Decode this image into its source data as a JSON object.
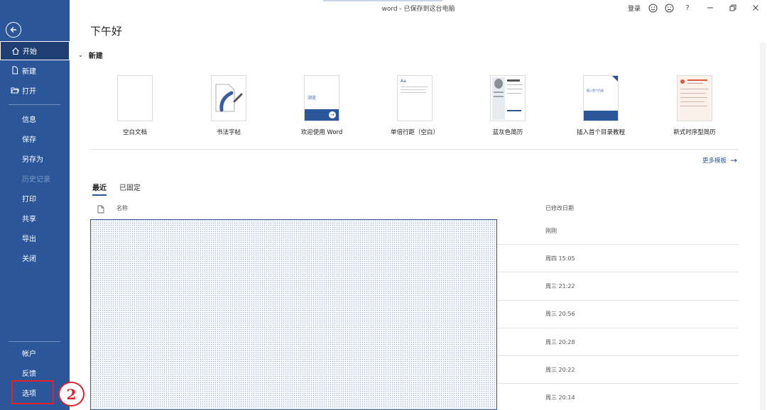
{
  "window": {
    "title": "word  -  已保存到这台电脑",
    "signin": "登录",
    "icons": [
      "smile-icon",
      "frown-icon",
      "help-icon",
      "minimize-icon",
      "restore-icon",
      "close-icon"
    ]
  },
  "sidebar": {
    "home": "开始",
    "new": "新建",
    "open": "打开",
    "info": "信息",
    "save": "保存",
    "save_as": "另存为",
    "history": "历史记录",
    "print": "打印",
    "share": "共享",
    "export": "导出",
    "close": "关闭",
    "account": "帐户",
    "feedback": "反馈",
    "options": "选项"
  },
  "annotation": {
    "marker": "2"
  },
  "main": {
    "greeting": "下午好",
    "new_section": "新建",
    "templates": [
      {
        "label": "空白文档"
      },
      {
        "label": "书法字帖"
      },
      {
        "label": "欢迎使用 Word",
        "thumb_text": "浏览"
      },
      {
        "label": "单倍行距（空白）",
        "thumb_text": "Aa"
      },
      {
        "label": "蓝灰色简历"
      },
      {
        "label": "插入首个目录教程",
        "thumb_text": "插入首个目录"
      },
      {
        "label": "新式时序型简历"
      }
    ],
    "more_templates": "更多模板",
    "tabs": {
      "recent": "最近",
      "pinned": "已固定"
    },
    "columns": {
      "name": "名称",
      "modified": "已修改日期"
    },
    "file_dates": [
      "刚刚",
      "周四 15:05",
      "周三 21:22",
      "周三 20:56",
      "周三 20:28",
      "周三 20:22",
      "周三 20:14"
    ]
  },
  "colors": {
    "sidebar": "#2b579a",
    "sidebar_selected": "#1e3e74",
    "annotation_red": "#e0202a"
  }
}
